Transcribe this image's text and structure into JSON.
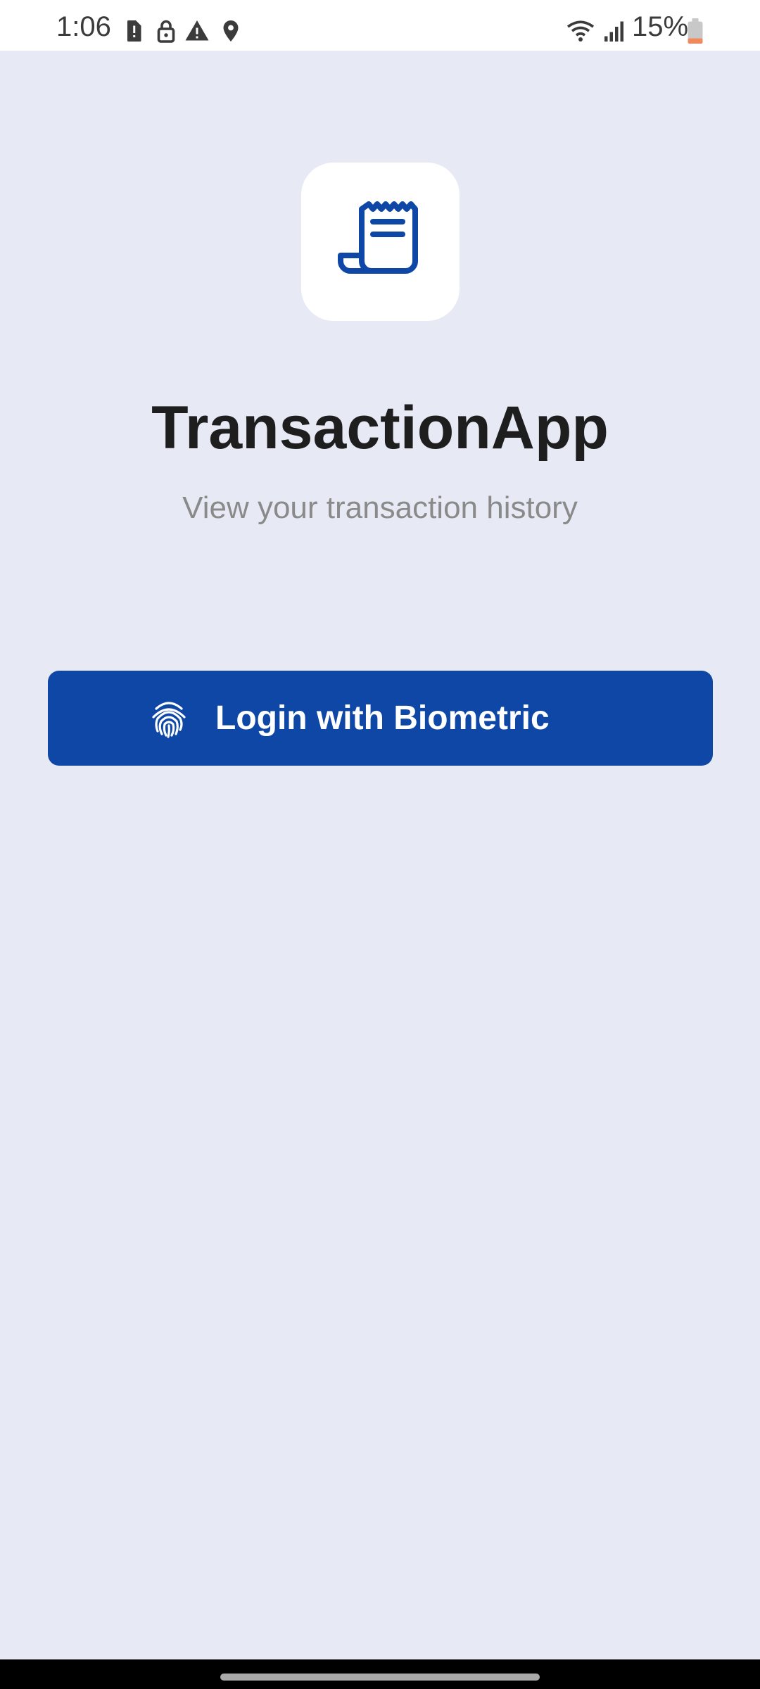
{
  "status_bar": {
    "time": "1:06",
    "battery": "15%",
    "icons": [
      "sim-alert-icon",
      "lock-icon",
      "warning-icon",
      "location-icon",
      "wifi-icon",
      "signal-icon",
      "battery-icon"
    ]
  },
  "app": {
    "icon": "receipt-icon",
    "title": "TransactionApp",
    "subtitle": "View your transaction history",
    "accent_color": "#0f47a6"
  },
  "login_button": {
    "icon": "fingerprint-icon",
    "label": "Login with Biometric"
  }
}
